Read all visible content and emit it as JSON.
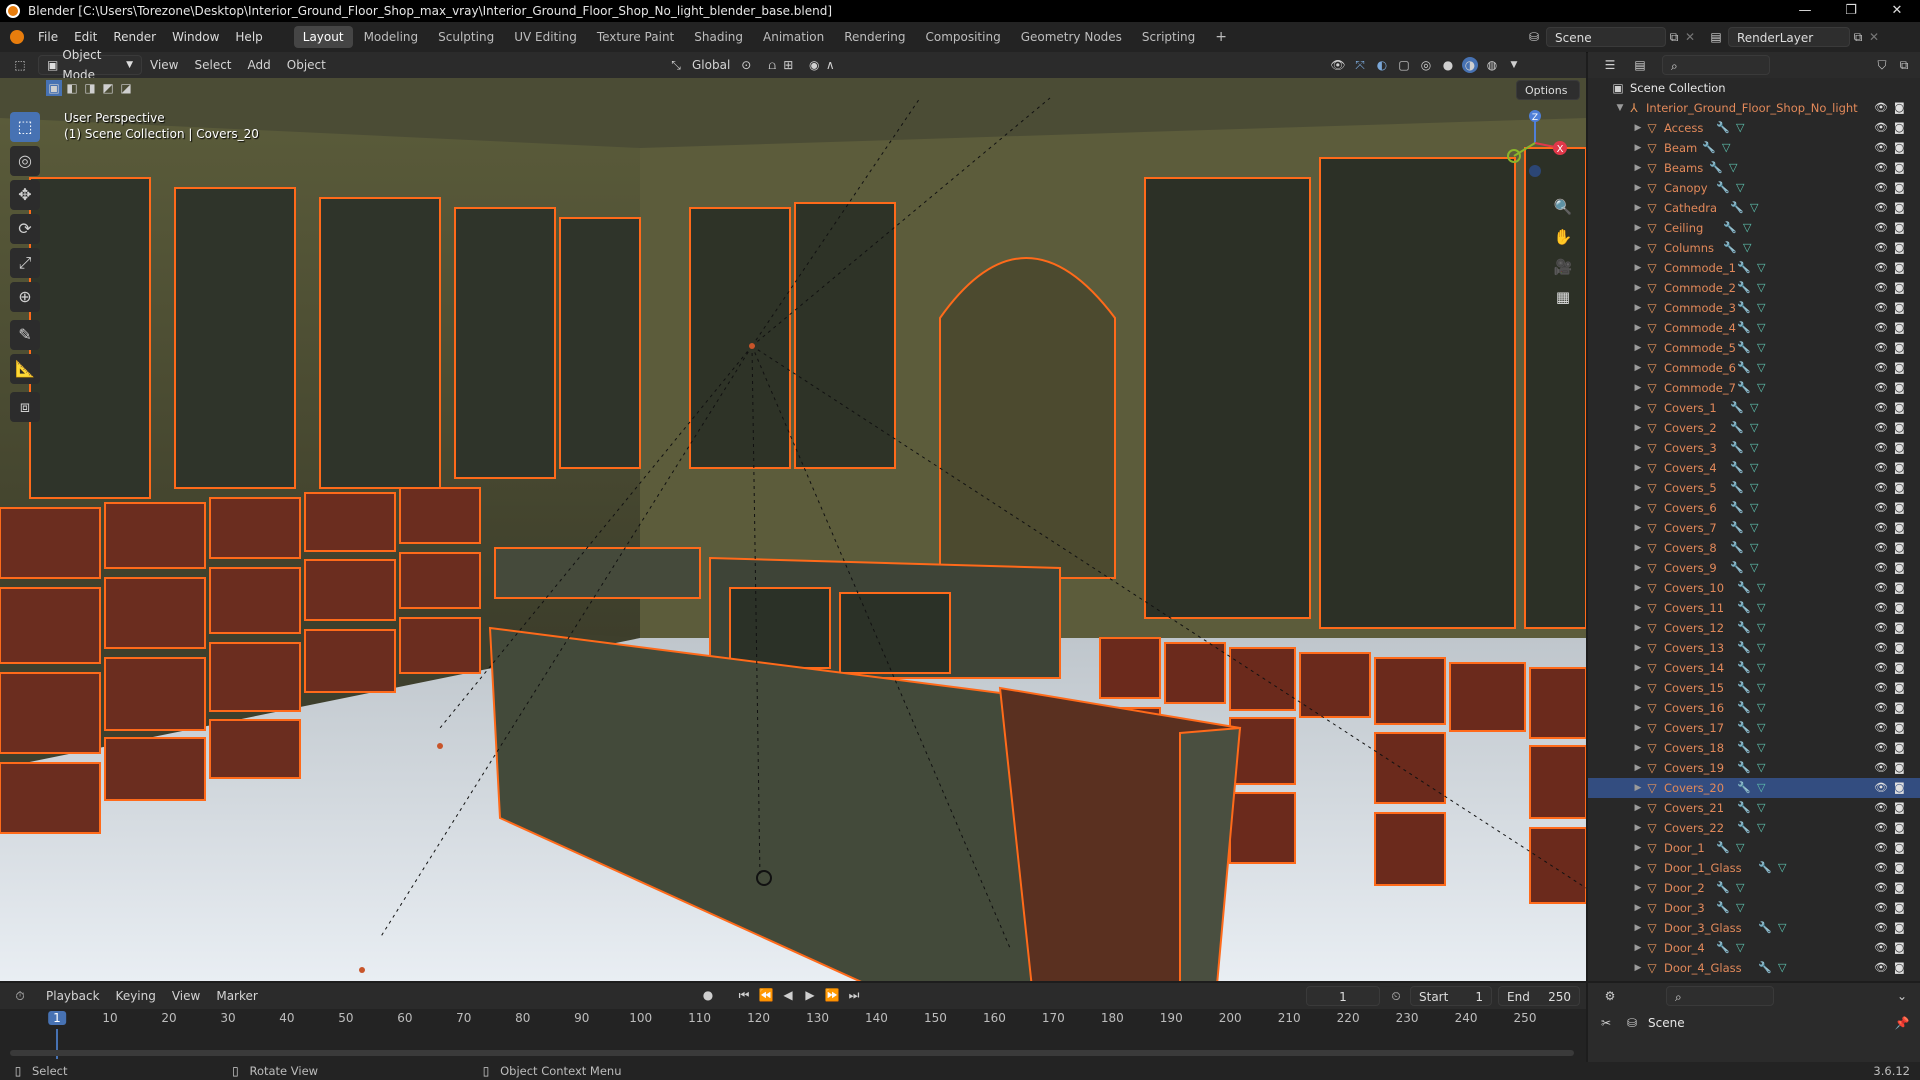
{
  "window": {
    "title": "Blender [C:\\Users\\Torezone\\Desktop\\Interior_Ground_Floor_Shop_max_vray\\Interior_Ground_Floor_Shop_No_light_blender_base.blend]",
    "minimize": "—",
    "restore": "❐",
    "close": "✕"
  },
  "menus": [
    "File",
    "Edit",
    "Render",
    "Window",
    "Help"
  ],
  "workspaces": [
    {
      "label": "Layout",
      "active": true
    },
    {
      "label": "Modeling",
      "active": false
    },
    {
      "label": "Sculpting",
      "active": false
    },
    {
      "label": "UV Editing",
      "active": false
    },
    {
      "label": "Texture Paint",
      "active": false
    },
    {
      "label": "Shading",
      "active": false
    },
    {
      "label": "Animation",
      "active": false
    },
    {
      "label": "Rendering",
      "active": false
    },
    {
      "label": "Compositing",
      "active": false
    },
    {
      "label": "Geometry Nodes",
      "active": false
    },
    {
      "label": "Scripting",
      "active": false
    }
  ],
  "add_workspace": "+",
  "scene_field": "Scene",
  "renderlayer_field": "RenderLayer",
  "viewport_header": {
    "mode": "Object Mode",
    "menus": [
      "View",
      "Select",
      "Add",
      "Object"
    ],
    "transform": "Global",
    "options": "Options"
  },
  "viewport_info": {
    "line1": "User Perspective",
    "line2": "(1) Scene Collection | Covers_20"
  },
  "gizmo": {
    "z": "Z",
    "x": "X"
  },
  "outliner": {
    "root": "Scene Collection",
    "collection": "Interior_Ground_Floor_Shop_No_light",
    "selected": "Covers_20",
    "objects": [
      "Access",
      "Beam",
      "Beams",
      "Canopy",
      "Cathedra",
      "Ceiling",
      "Columns",
      "Commode_1",
      "Commode_2",
      "Commode_3",
      "Commode_4",
      "Commode_5",
      "Commode_6",
      "Commode_7",
      "Covers_1",
      "Covers_2",
      "Covers_3",
      "Covers_4",
      "Covers_5",
      "Covers_6",
      "Covers_7",
      "Covers_8",
      "Covers_9",
      "Covers_10",
      "Covers_11",
      "Covers_12",
      "Covers_13",
      "Covers_14",
      "Covers_15",
      "Covers_16",
      "Covers_17",
      "Covers_18",
      "Covers_19",
      "Covers_20",
      "Covers_21",
      "Covers_22",
      "Door_1",
      "Door_1_Glass",
      "Door_2",
      "Door_3",
      "Door_3_Glass",
      "Door_4",
      "Door_4_Glass"
    ]
  },
  "timeline": {
    "menus": [
      "Playback",
      "Keying",
      "View",
      "Marker"
    ],
    "current_frame": "1",
    "start_label": "Start",
    "start": "1",
    "end_label": "End",
    "end": "250",
    "ticks": [
      "1",
      "10",
      "20",
      "30",
      "40",
      "50",
      "60",
      "70",
      "80",
      "90",
      "100",
      "110",
      "120",
      "130",
      "140",
      "150",
      "160",
      "170",
      "180",
      "190",
      "200",
      "210",
      "220",
      "230",
      "240",
      "250"
    ]
  },
  "properties": {
    "scene_label": "Scene"
  },
  "status": {
    "select": "Select",
    "rotate": "Rotate View",
    "context": "Object Context Menu",
    "version": "3.6.12"
  },
  "colors": {
    "accent": "#4772b3",
    "selection_outline": "#ff6a1a",
    "object_name": "#e2895a"
  }
}
